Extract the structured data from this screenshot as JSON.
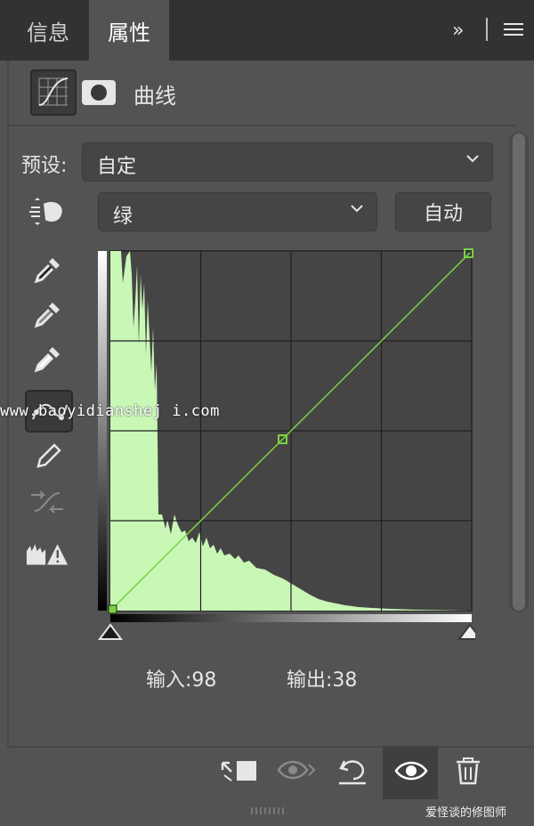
{
  "tabs": [
    {
      "label": "信息",
      "active": false
    },
    {
      "label": "属性",
      "active": true
    }
  ],
  "tab_actions": {
    "more": "»",
    "menu_icon": "hamburger-icon"
  },
  "header": {
    "title": "曲线",
    "icons": [
      "curves-adjustment-icon",
      "layer-mask-icon"
    ]
  },
  "preset": {
    "label": "预设:",
    "value": "自定"
  },
  "channel": {
    "value": "绿"
  },
  "auto_button": "自动",
  "tools": [
    "target-adjust-icon",
    "black-eyedropper-icon",
    "gray-eyedropper-icon",
    "white-eyedropper-icon",
    "curve-points-icon",
    "pencil-icon",
    "smooth-icon",
    "clipping-warning-icon"
  ],
  "curve": {
    "channel_color": "#7cd142",
    "histogram_color": "#c9f7b6",
    "points": [
      [
        0,
        0
      ],
      [
        98,
        98
      ],
      [
        255,
        255
      ]
    ],
    "selected_point": {
      "input": 98,
      "output": 38
    }
  },
  "readout": {
    "input_label": "输入:98",
    "output_label": "输出:38"
  },
  "footer": {
    "buttons": [
      "clip-to-layer-icon",
      "view-previous-state-icon",
      "reset-icon",
      "visibility-eye-icon",
      "delete-trash-icon"
    ]
  },
  "watermarks": {
    "url": "www.baoyidianshej i.com",
    "credit": "爱怪谈的修图师"
  },
  "colors": {
    "panel_bg": "#535353",
    "tabbar_bg": "#323232",
    "graph_bg": "#454545",
    "accent_green": "#7cd142"
  }
}
